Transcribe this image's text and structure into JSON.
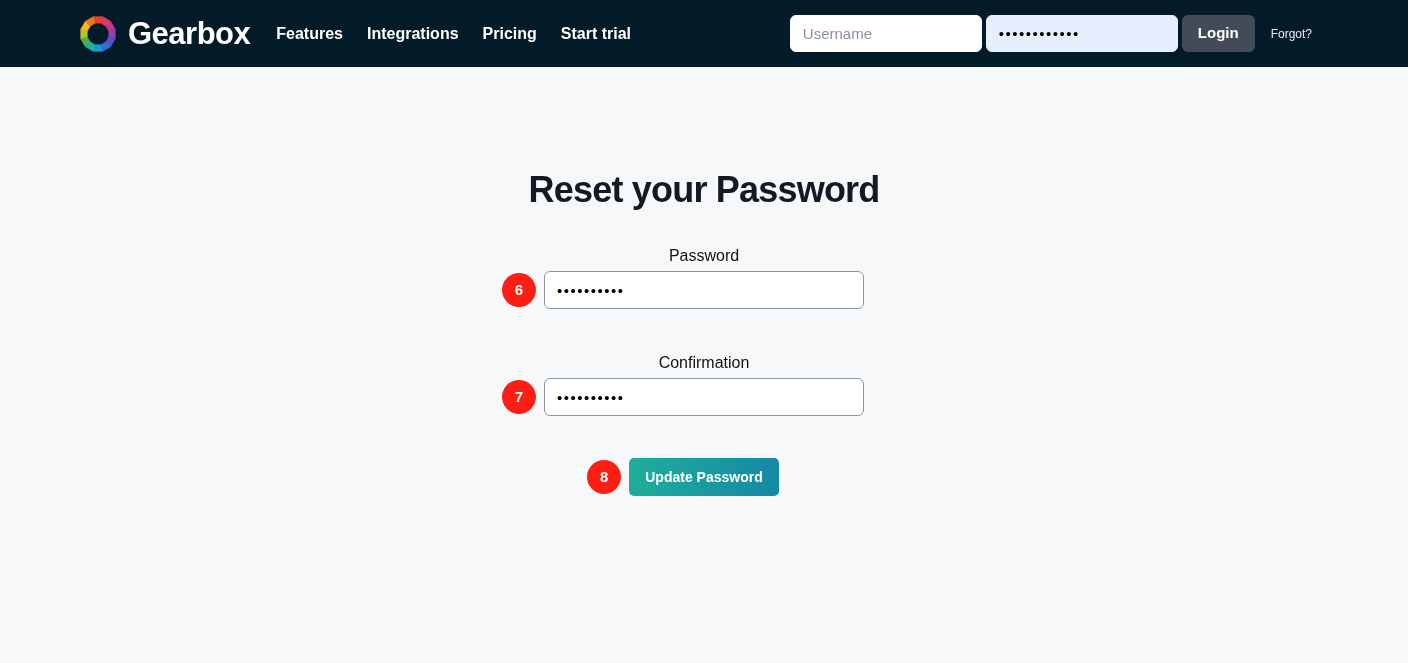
{
  "navbar": {
    "brand": "Gearbox",
    "links": [
      "Features",
      "Integrations",
      "Pricing",
      "Start trial"
    ],
    "login": {
      "username": {
        "placeholder": "Username"
      },
      "password": {
        "value": "••••••••••••",
        "autofilled": true
      },
      "button": "Login",
      "forgot": "Forgot?"
    }
  },
  "main": {
    "title": "Reset your Password",
    "fields": [
      {
        "label": "Password",
        "value": "••••••••••",
        "marker": "6"
      },
      {
        "label": "Confirmation",
        "value": "••••••••••",
        "marker": "7"
      }
    ],
    "submit": {
      "label": "Update Password",
      "marker": "8"
    }
  }
}
